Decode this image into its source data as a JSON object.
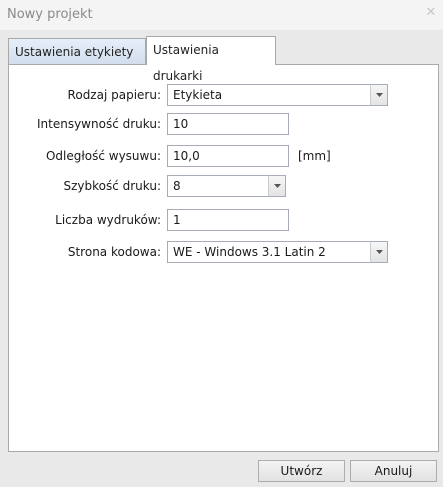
{
  "window": {
    "title": "Nowy projekt",
    "close_icon": "close-icon"
  },
  "tabs": [
    {
      "label": "Ustawienia etykiety",
      "active": false
    },
    {
      "label": "Ustawienia drukarki",
      "active": true
    }
  ],
  "form": {
    "paper_type": {
      "label": "Rodzaj papieru:",
      "value": "Etykieta"
    },
    "intensity": {
      "label": "Intensywność druku:",
      "value": "10"
    },
    "feed_distance": {
      "label": "Odległość wysuwu:",
      "value": "10,0",
      "unit": "[mm]"
    },
    "print_speed": {
      "label": "Szybkość druku:",
      "value": "8"
    },
    "copies": {
      "label": "Liczba wydruków:",
      "value": "1"
    },
    "code_page": {
      "label": "Strona kodowa:",
      "value": "WE - Windows 3.1 Latin 2"
    }
  },
  "buttons": {
    "create": "Utwórz",
    "cancel": "Anuluj"
  },
  "colors": {
    "panel_bg": "#ffffff",
    "window_bg": "#e9e9e9",
    "tab_inactive_bg": "#dbe5f1",
    "border": "#a9a9a9"
  }
}
